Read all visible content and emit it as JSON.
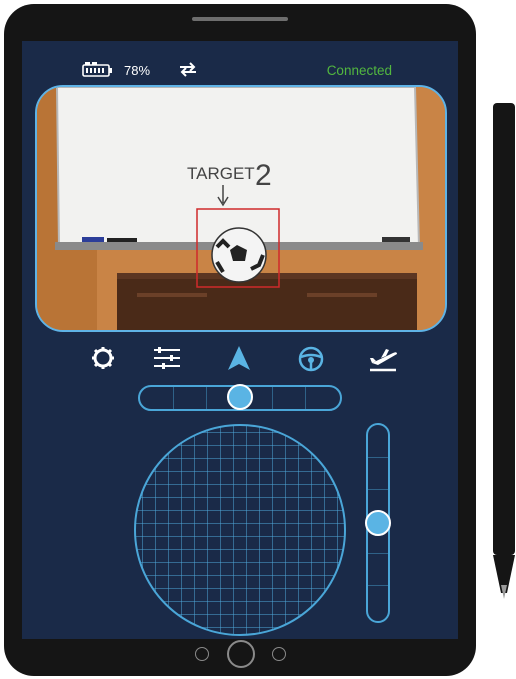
{
  "status_bar": {
    "battery_icon": "battery-icon",
    "battery_percent": "78%",
    "sync_icon": "sync-icon",
    "connection_status": "Connected",
    "connection_color": "#52b73f"
  },
  "camera_feed": {
    "whiteboard_text": "TARGET",
    "whiteboard_number": "2",
    "target_box_color": "#d02a2a"
  },
  "nav": [
    {
      "icon": "settings-gear-icon"
    },
    {
      "icon": "sliders-list-icon"
    },
    {
      "icon": "navigation-arrow-icon",
      "active": true
    },
    {
      "icon": "steering-wheel-icon"
    },
    {
      "icon": "takeoff-plane-icon"
    }
  ],
  "controls": {
    "horizontal_slider_value": 0.5,
    "vertical_slider_value": 0.5
  },
  "colors": {
    "screen_bg": "#1a2a48",
    "accent": "#5ab4e4",
    "outline": "#4aa6d8"
  }
}
